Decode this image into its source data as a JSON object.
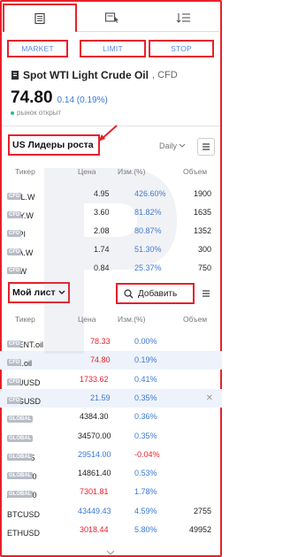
{
  "colors": {
    "accent": "#e8202a",
    "link": "#5b87e6",
    "up": "#3a78d8",
    "down": "#e8202a",
    "status": "#2dbd8a"
  },
  "tabs": [
    {
      "icon": "order-ticket-icon"
    },
    {
      "icon": "chart-pointer-icon"
    },
    {
      "icon": "list-sort-icon"
    }
  ],
  "order_buttons": {
    "market": "MARKET",
    "limit": "LIMIT",
    "stop": "STOP"
  },
  "instrument": {
    "name": "Spot WTI Light Crude Oil",
    "type": ", CFD",
    "price": "74.80",
    "change": "0.14 (0.19%)",
    "status": "рынок открыт"
  },
  "leaders": {
    "title": "US Лидеры роста",
    "period": "Daily",
    "columns": {
      "symbol": "Тикер",
      "price": "Цена",
      "change": "Изм.(%)",
      "volume": "Объем"
    },
    "rows": [
      {
        "symbol": "OWL.W",
        "badge": "CFD",
        "price": "4.95",
        "change": "426.60%",
        "volume": "1900"
      },
      {
        "symbol": "DMY.W",
        "badge": "CFD",
        "price": "3.60",
        "change": "81.82%",
        "volume": "1635"
      },
      {
        "symbol": "SDPI",
        "badge": "CFD",
        "price": "2.08",
        "change": "80.87%",
        "volume": "1352"
      },
      {
        "symbol": "OPA.W",
        "badge": "CFD",
        "price": "1.74",
        "change": "51.30%",
        "volume": "300"
      },
      {
        "symbol": "PV.W",
        "badge": "CFD",
        "price": "0.84",
        "change": "25.37%",
        "volume": "750"
      }
    ]
  },
  "watchlist": {
    "title": "Мой лист",
    "add_label": "Добавить",
    "columns": {
      "symbol": "Тикер",
      "price": "Цена",
      "change": "Изм.(%)",
      "volume": "Объем"
    },
    "rows": [
      {
        "symbol": "BRENT.oil",
        "badge": "CFD",
        "price": "78.33",
        "price_color": "#e8202a",
        "change": "0.00%",
        "volume": ""
      },
      {
        "symbol": "WTI.oil",
        "badge": "CFD",
        "price": "74.80",
        "price_color": "#e8202a",
        "change": "0.19%",
        "volume": ""
      },
      {
        "symbol": "XAUUSD",
        "badge": "CFD",
        "price": "1733.62",
        "price_color": "#e8202a",
        "change": "0.41%",
        "volume": ""
      },
      {
        "symbol": "XAGUSD",
        "badge": "CFD",
        "price": "21.59",
        "price_color": "#3a78d8",
        "change": "0.35%",
        "volume": ""
      },
      {
        "symbol": "US500",
        "badge": "GLOBAL",
        "price": "4384.30",
        "price_color": "#222222",
        "change": "0.36%",
        "volume": ""
      },
      {
        "symbol": "US30",
        "badge": "GLOBAL",
        "price": "34570.00",
        "price_color": "#222222",
        "change": "0.35%",
        "volume": ""
      },
      {
        "symbol": "JPY225",
        "badge": "GLOBAL",
        "price": "29514.00",
        "price_color": "#3a78d8",
        "change": "-0.04%",
        "volume": ""
      },
      {
        "symbol": "NAS100",
        "badge": "GLOBAL",
        "price": "14861.40",
        "price_color": "#222222",
        "change": "0.53%",
        "volume": ""
      },
      {
        "symbol": "AUS200",
        "badge": "GLOBAL",
        "price": "7301.81",
        "price_color": "#e8202a",
        "change": "1.78%",
        "volume": ""
      },
      {
        "symbol": "BTCUSD",
        "badge": "",
        "price": "43449.43",
        "price_color": "#3a78d8",
        "change": "4.59%",
        "volume": "2755"
      },
      {
        "symbol": "ETHUSD",
        "badge": "",
        "price": "3018.44",
        "price_color": "#e8202a",
        "change": "5.80%",
        "volume": "49952"
      }
    ]
  }
}
